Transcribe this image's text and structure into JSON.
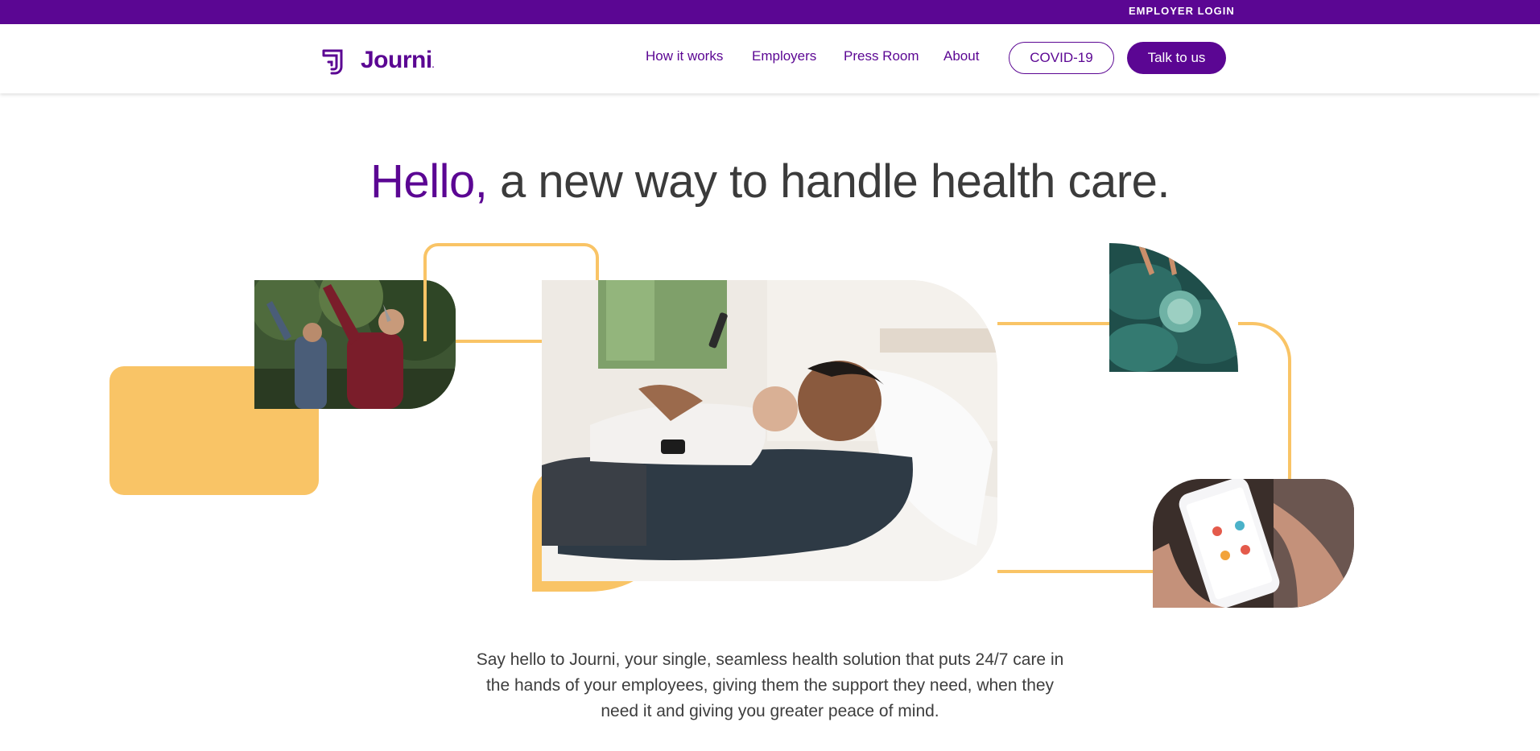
{
  "topbar": {
    "login_label": "EMPLOYER LOGIN"
  },
  "brand": {
    "name": "Journi",
    "dot": "."
  },
  "nav": {
    "links": [
      "How it works",
      "Employers",
      "Press Room",
      "About"
    ],
    "covid_label": "COVID-19",
    "cta_label": "Talk to us"
  },
  "hero": {
    "title_hello": "Hello,",
    "title_rest": " a new way to handle health care.",
    "intro": "Say hello to Journi, your single, seamless health solution that puts 24/7 care in the hands of your employees, giving them the support they need, when they need it and giving you greater peace of mind."
  },
  "colors": {
    "brand_purple": "#5b0693",
    "accent_yellow": "#f9c466",
    "text_dark": "#3b3b3b"
  },
  "icons": {
    "logo": "journi-logo-icon"
  }
}
